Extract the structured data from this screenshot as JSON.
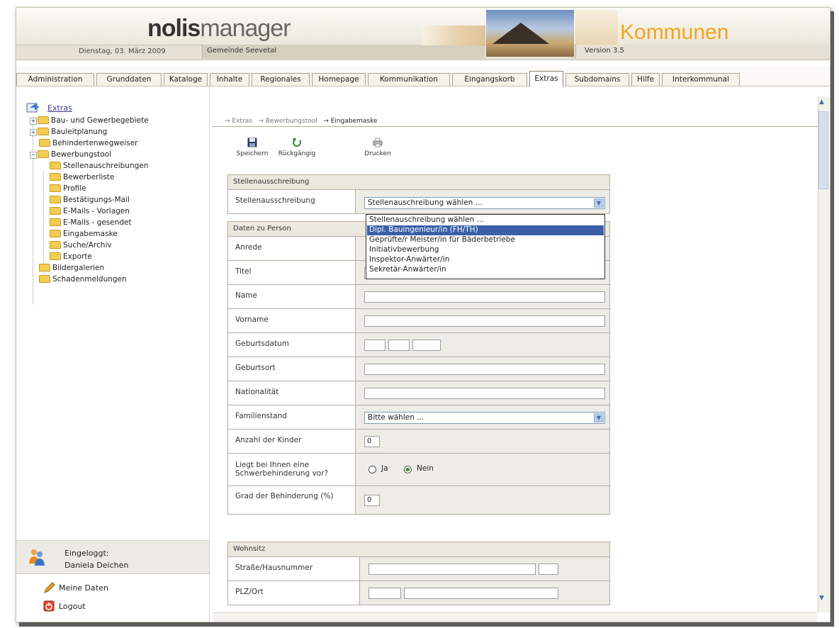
{
  "header": {
    "logo_bold": "nolis",
    "logo_light": "manager",
    "date": "Dienstag, 03. März 2009",
    "gemeinde": "Gemeinde Seevetal",
    "product": "Kommunen",
    "version": "Version 3.5",
    "accent": "#f0a51d"
  },
  "tabs": [
    "Administration",
    "Grunddaten",
    "Kataloge",
    "Inhalte",
    "Regionales",
    "Homepage",
    "Kommunikation",
    "Eingangskorb",
    "Extras",
    "Subdomains",
    "Hilfe",
    "Interkommunal"
  ],
  "active_tab": "Extras",
  "sidebar": {
    "root": "Extras",
    "items": [
      "Bau- und Gewerbegebiete",
      "Bauleitplanung",
      "Behindertenwegweiser",
      "Bewerbungstool",
      "Stellenauschreibungen",
      "Bewerberliste",
      "Profile",
      "Bestätigungs-Mail",
      "E-Mails - Vorlagen",
      "E-Mails - gesendet",
      "Eingabemaske",
      "Suche/Archiv",
      "Exporte",
      "Bildergalerien",
      "Schadenmeldungen"
    ],
    "login_label": "Eingeloggt:",
    "login_name": "Daniela Deichen",
    "meine_daten": "Meine Daten",
    "logout": "Logout"
  },
  "breadcrumb": [
    "→ Extras",
    "→ Bewerbungstool",
    "→ Eingabemaske"
  ],
  "toolbar": {
    "save": "Speichern",
    "undo": "Rückgängig",
    "print": "Drucken"
  },
  "form": {
    "section1": "Stellenausschreibung",
    "stellen_label": "Stellenausschreibung",
    "stellen_value": "Stellenauschreibung wählen ...",
    "dropdown_options": [
      "Stellenauschreibung wählen ...",
      "Dipl. Bauingenieur/in (FH/TH)",
      "Geprüfte/r Meister/in für Bäderbetriebe",
      "Initiativbewerbung",
      "Inspektor-Anwärter/in",
      "Sekretär-Anwärter/in"
    ],
    "section2": "Daten zu Person",
    "anrede": "Anrede",
    "titel": "Titel",
    "name": "Name",
    "vorname": "Vorname",
    "geburtsdatum": "Geburtsdatum",
    "geburtsort": "Geburtsort",
    "nationalitaet": "Nationalität",
    "familienstand": "Familienstand",
    "familienstand_value": "Bitte wählen ...",
    "kinder": "Anzahl der Kinder",
    "kinder_value": "0",
    "schwerbehinderung": "Liegt bei Ihnen eine Schwerbehinderung vor?",
    "ja": "Ja",
    "nein": "Nein",
    "grad": "Grad der Behinderung (%)",
    "grad_value": "0",
    "section3": "Wohnsitz",
    "strasse": "Straße/Hausnummer",
    "plz": "PLZ/Ort"
  }
}
